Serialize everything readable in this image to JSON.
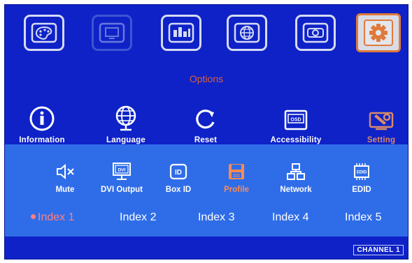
{
  "categories": [
    {
      "name": "palette",
      "icon": "palette-icon"
    },
    {
      "name": "display",
      "icon": "monitor-icon"
    },
    {
      "name": "video-wall",
      "icon": "video-wall-icon"
    },
    {
      "name": "network",
      "icon": "globe-icon"
    },
    {
      "name": "projector",
      "icon": "projector-icon"
    },
    {
      "name": "options",
      "icon": "gear-icon"
    }
  ],
  "menu_title": "Options",
  "options": [
    {
      "label": "Information",
      "icon": "info-icon"
    },
    {
      "label": "Language",
      "icon": "globe-icon"
    },
    {
      "label": "Reset",
      "icon": "reset-icon"
    },
    {
      "label": "Accessibility",
      "icon": "osd-icon"
    },
    {
      "label": "Setting",
      "icon": "wrench-icon"
    }
  ],
  "submenu": [
    {
      "label": "Mute",
      "icon": "mute-icon"
    },
    {
      "label": "DVI Output",
      "icon": "dvi-icon"
    },
    {
      "label": "Box ID",
      "icon": "id-icon"
    },
    {
      "label": "Profile",
      "icon": "floppy-disk-icon"
    },
    {
      "label": "Network",
      "icon": "network-icon"
    },
    {
      "label": "EDID",
      "icon": "edid-chip-icon"
    }
  ],
  "indexes": [
    "Index 1",
    "Index 2",
    "Index 3",
    "Index 4",
    "Index 5"
  ],
  "selected_index": "Index 1",
  "channel": "CHANNEL 1",
  "colors": {
    "osd_background": "#0e22c8",
    "panel": "#2f6de8",
    "accent_orange": "#e07a3a",
    "selected_index": "#ff7f7f"
  }
}
